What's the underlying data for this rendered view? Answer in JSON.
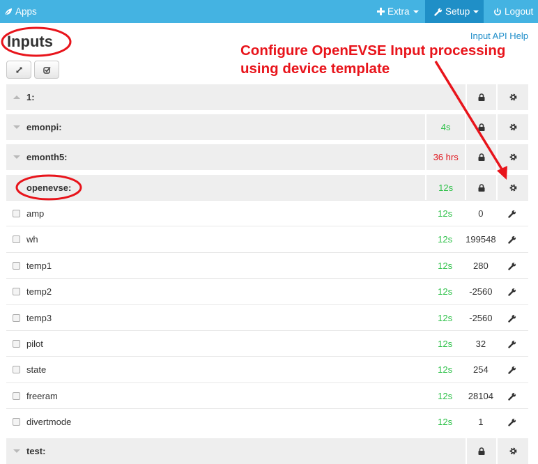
{
  "nav": {
    "apps_label": "Apps",
    "extra_label": "Extra",
    "setup_label": "Setup",
    "logout_label": "Logout"
  },
  "page": {
    "title": "Inputs",
    "help_link": "Input API Help"
  },
  "annotation": {
    "line1": "Configure OpenEVSE Input processing",
    "line2": "using device template"
  },
  "nodes": [
    {
      "name": "1:",
      "time": "",
      "time_status": "none"
    },
    {
      "name": "emonpi:",
      "time": "4s",
      "time_status": "ok"
    },
    {
      "name": "emonth5:",
      "time": "36 hrs",
      "time_status": "stale"
    },
    {
      "name": "openevse:",
      "time": "12s",
      "time_status": "ok"
    },
    {
      "name": "test:",
      "time": "",
      "time_status": "none"
    }
  ],
  "inputs": [
    {
      "name": "amp",
      "time": "12s",
      "value": "0"
    },
    {
      "name": "wh",
      "time": "12s",
      "value": "199548"
    },
    {
      "name": "temp1",
      "time": "12s",
      "value": "280"
    },
    {
      "name": "temp2",
      "time": "12s",
      "value": "-2560"
    },
    {
      "name": "temp3",
      "time": "12s",
      "value": "-2560"
    },
    {
      "name": "pilot",
      "time": "12s",
      "value": "32"
    },
    {
      "name": "state",
      "time": "12s",
      "value": "254"
    },
    {
      "name": "freeram",
      "time": "12s",
      "value": "28104"
    },
    {
      "name": "divertmode",
      "time": "12s",
      "value": "1"
    }
  ],
  "colors": {
    "navbar": "#44b3e2",
    "navbar_active": "#1f8fc7",
    "ok": "#2fc14a",
    "stale": "#e0161e",
    "annotation": "#e8141b"
  },
  "icons": {
    "apps": "leaf-icon",
    "extra": "plus-icon",
    "setup": "wrench-icon",
    "logout": "power-icon",
    "expand": "expand-icon",
    "select": "check-square-icon",
    "lock": "lock-icon",
    "config": "gear-icon",
    "process": "wrench-icon"
  }
}
